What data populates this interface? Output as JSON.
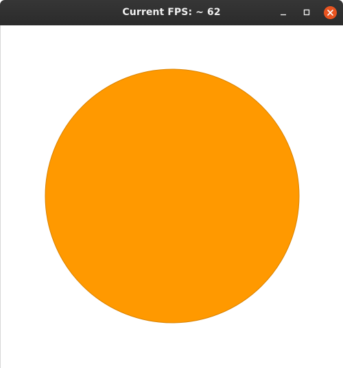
{
  "window": {
    "title": "Current FPS: ~ 62"
  },
  "window_controls": {
    "minimize": "minimize-icon",
    "maximize": "maximize-icon",
    "close": "close-icon"
  },
  "canvas": {
    "shape": "circle",
    "fill_color": "#ff9900",
    "stroke_color": "#d98200",
    "background_color": "#ffffff"
  },
  "colors": {
    "titlebar": "#2f2f2f",
    "title_text": "#f0f0f0",
    "close_button": "#e95420"
  }
}
